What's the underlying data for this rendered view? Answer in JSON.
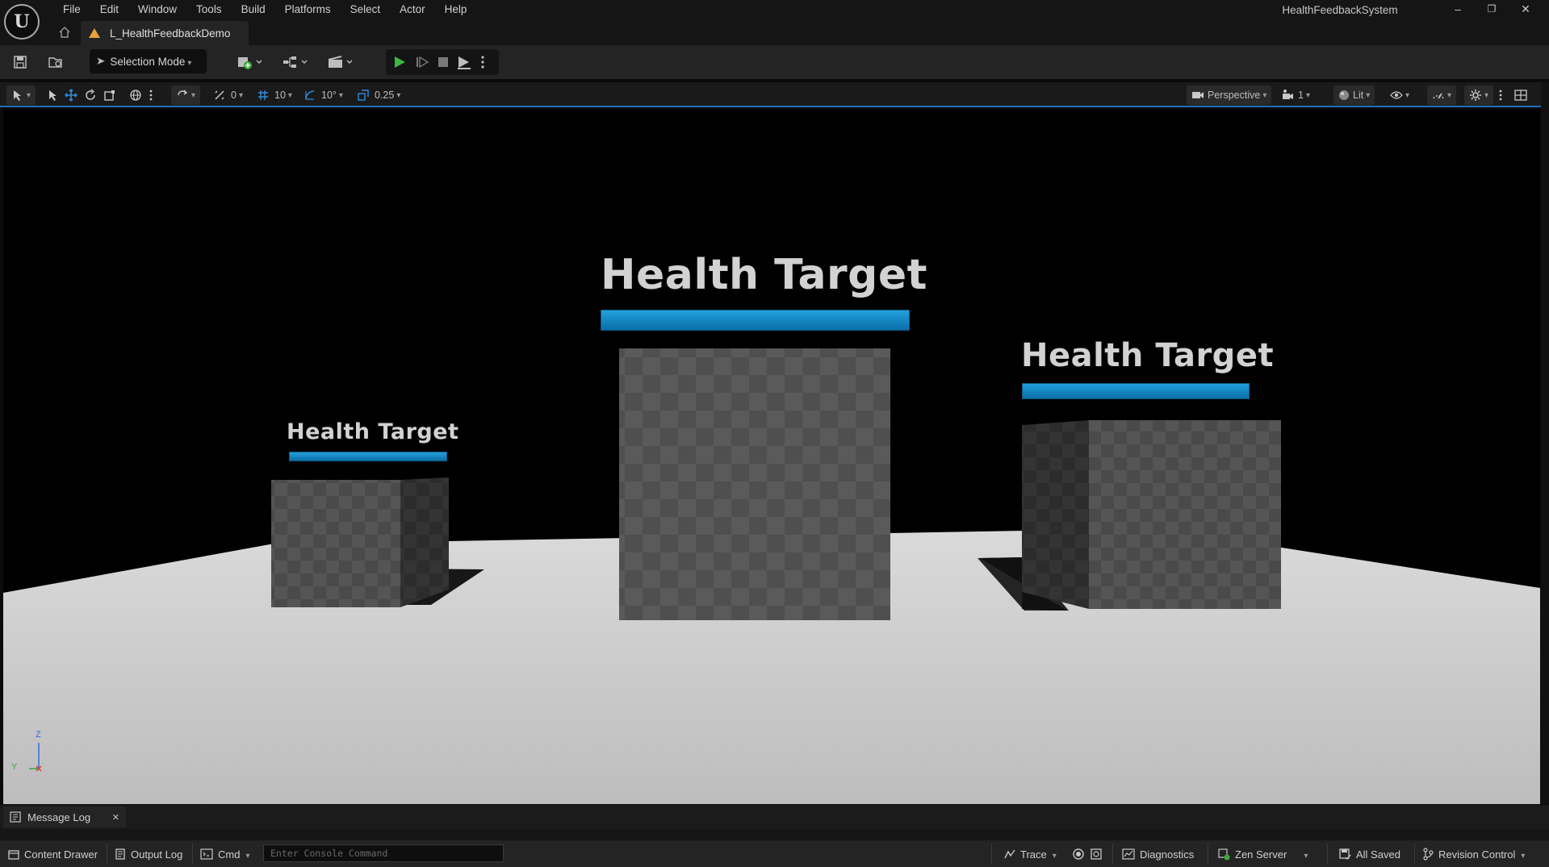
{
  "window": {
    "project_name": "HealthFeedbackSystem",
    "minimize": "–",
    "restore": "❐",
    "close": "✕"
  },
  "menu": [
    "File",
    "Edit",
    "Window",
    "Tools",
    "Build",
    "Platforms",
    "Select",
    "Actor",
    "Help"
  ],
  "level_tab": {
    "label": "L_HealthFeedbackDemo"
  },
  "toolbar": {
    "selection_mode": "Selection Mode"
  },
  "viewport_toolbar": {
    "rotate_snap_value": "0",
    "grid_snap_value": "10",
    "angle_snap_value": "10°",
    "scale_snap_value": "0.25",
    "view_mode": "Perspective",
    "camera_speed": "1",
    "lighting": "Lit"
  },
  "viewport": {
    "labels": [
      "Health Target",
      "Health Target",
      "Health Target"
    ],
    "axis": {
      "z": "Z",
      "y": "Y",
      "x": "X"
    },
    "colors": {
      "health_bar": "#1889c9",
      "background": "#000000",
      "floor": "#cfcfcf"
    }
  },
  "message_log": {
    "tab_label": "Message Log",
    "close": "✕"
  },
  "statusbar": {
    "content_drawer": "Content Drawer",
    "output_log": "Output Log",
    "cmd": "Cmd",
    "console_placeholder": "Enter Console Command",
    "trace": "Trace",
    "diagnostics": "Diagnostics",
    "zen_server": "Zen Server",
    "all_saved": "All Saved",
    "revision_control": "Revision Control"
  }
}
